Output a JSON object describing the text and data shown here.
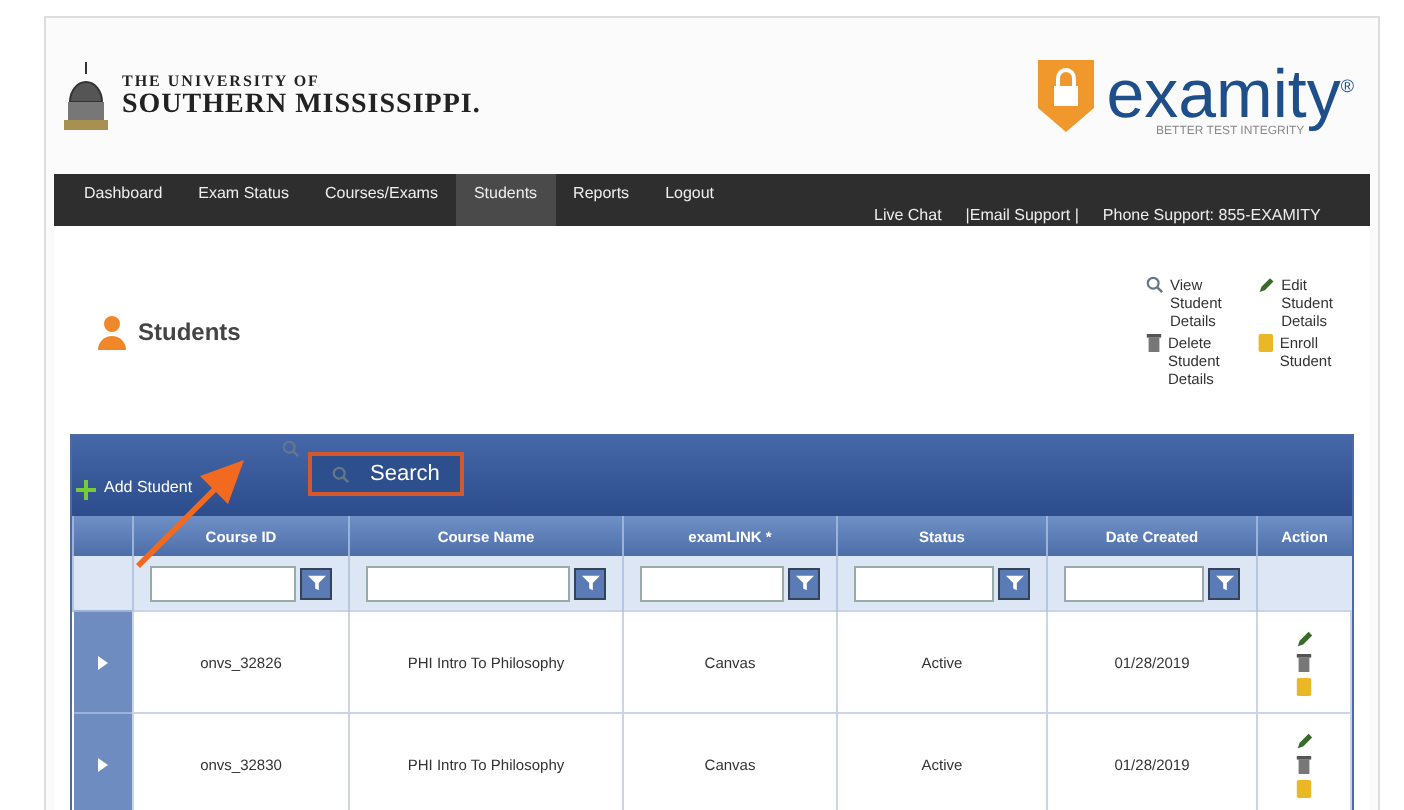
{
  "header": {
    "university": {
      "line1": "THE UNIVERSITY OF",
      "line2": "SOUTHERN MISSISSIPPI."
    },
    "brand": {
      "name": "examity$^{®}$",
      "tagline": "BETTER TEST INTEGRITY"
    }
  },
  "nav": {
    "items": [
      {
        "label": "Dashboard",
        "selected": false
      },
      {
        "label": "Exam Status",
        "selected": false
      },
      {
        "label": "Courses/Exams",
        "selected": false
      },
      {
        "label": "Students",
        "selected": true
      },
      {
        "label": "Reports",
        "selected": false
      },
      {
        "label": "Logout",
        "selected": false
      }
    ],
    "support": [
      "Live Chat",
      "|Email Support |",
      "Phone Support: 855-EXAMITY"
    ]
  },
  "page": {
    "title": "Students",
    "actions": [
      {
        "kind": "view",
        "label": "View Student Details"
      },
      {
        "kind": "edit",
        "label": "Edit Student Details"
      },
      {
        "kind": "delete",
        "label": "Delete Student Details"
      },
      {
        "kind": "enroll",
        "label": "Enroll Student"
      }
    ]
  },
  "grid": {
    "toolbar": {
      "add": "Add Student",
      "search": "Search"
    },
    "columns": [
      {
        "label": "Course ID",
        "filter": true
      },
      {
        "label": "Course Name",
        "filter": true
      },
      {
        "label": "examLINK *",
        "filter": true
      },
      {
        "label": "Status",
        "filter": true
      },
      {
        "label": "Date Created",
        "filter": true
      },
      {
        "label": "Action",
        "filter": false
      }
    ],
    "rows": [
      {
        "cells": [
          "onvs_32826",
          "PHI Intro To Philosophy",
          "Canvas",
          "Active",
          "01/28/2019"
        ]
      },
      {
        "cells": [
          "onvs_32830",
          "PHI Intro To Philosophy",
          "Canvas",
          "Active",
          "01/28/2019"
        ]
      }
    ]
  }
}
